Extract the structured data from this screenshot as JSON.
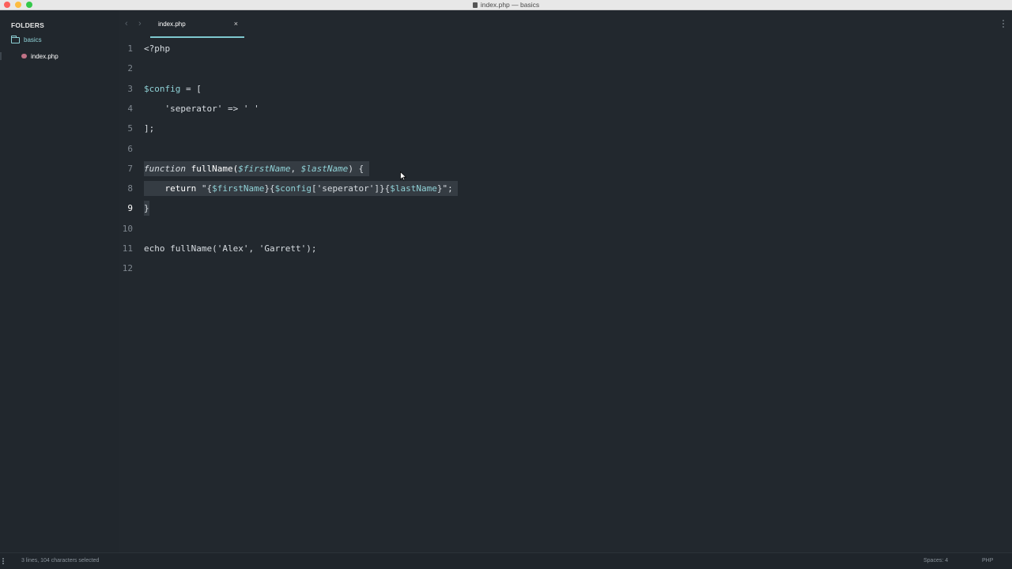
{
  "window": {
    "title": "index.php — basics"
  },
  "sidebar": {
    "header": "FOLDERS",
    "folder": "basics",
    "file": "index.php"
  },
  "tabs": {
    "active": {
      "label": "index.php",
      "close": "×"
    },
    "back": "‹",
    "forward": "›"
  },
  "editor": {
    "lines": [
      {
        "num": "1"
      },
      {
        "num": "2"
      },
      {
        "num": "3"
      },
      {
        "num": "4"
      },
      {
        "num": "5"
      },
      {
        "num": "6"
      },
      {
        "num": "7"
      },
      {
        "num": "8"
      },
      {
        "num": "9"
      },
      {
        "num": "10"
      },
      {
        "num": "11"
      },
      {
        "num": "12"
      }
    ],
    "tokens": {
      "l1": "<?php",
      "l3_var": "$config",
      "l3_rest": " = [",
      "l4": "    'seperator' => ' '",
      "l5": "];",
      "l7_kw": "function",
      "l7_fn": " fullName(",
      "l7_p1": "$firstName",
      "l7_comma": ", ",
      "l7_p2": "$lastName",
      "l7_end": ") {",
      "l8_ret": "    return ",
      "l8_q1": "\"{",
      "l8_v1": "$firstName",
      "l8_mid1": "}{",
      "l8_v2": "$config",
      "l8_mid2": "['seperator']}{",
      "l8_v3": "$lastName",
      "l8_end": "}\";",
      "l9": "}",
      "l11": "echo fullName('Alex', 'Garrett');"
    }
  },
  "status": {
    "selection": "3 lines, 104 characters selected",
    "indent": "Spaces: 4",
    "syntax": "PHP"
  },
  "colors": {
    "background": "#22282e",
    "accent": "#8fd1d6",
    "selection": "#353c43"
  }
}
